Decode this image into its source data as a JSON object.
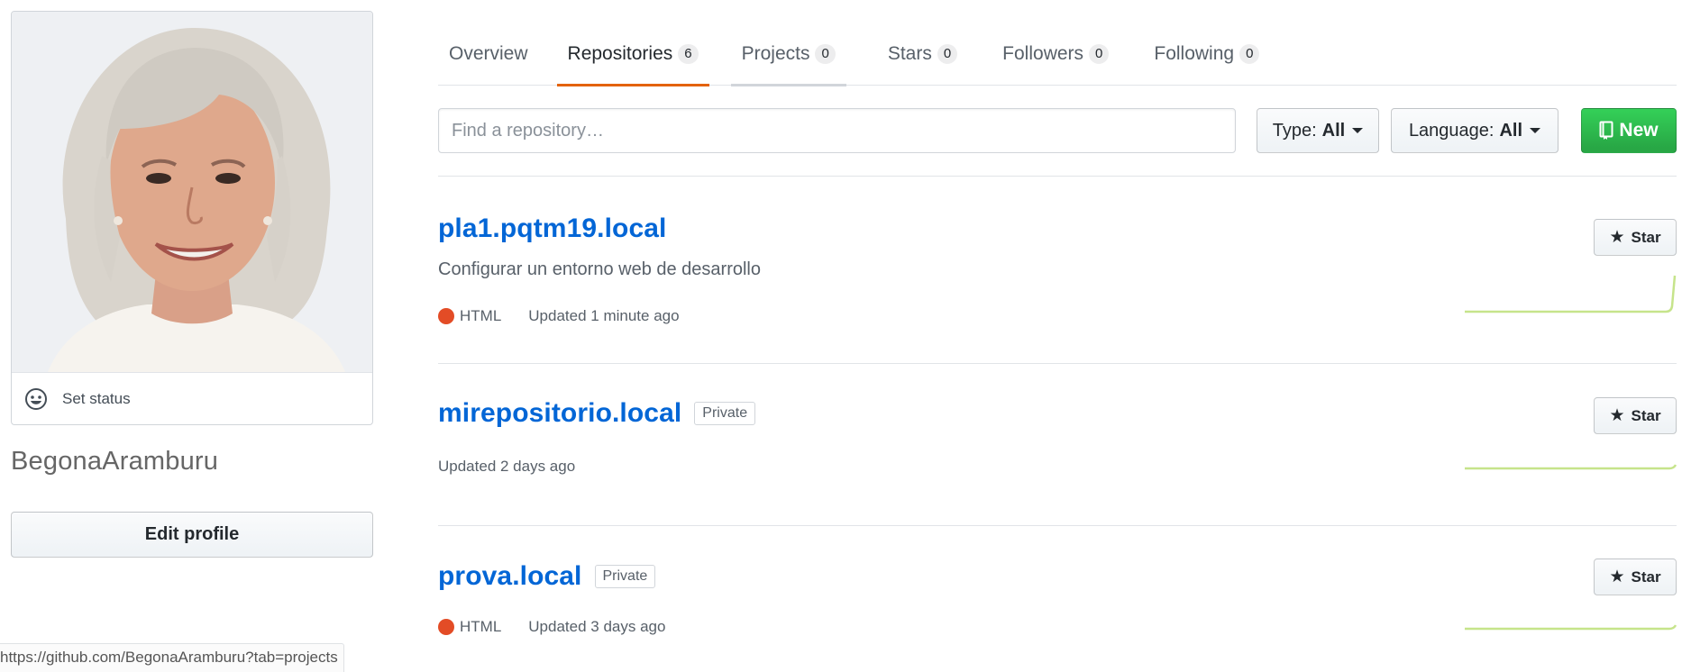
{
  "profile": {
    "set_status_label": "Set status",
    "username": "BegonaAramburu",
    "edit_profile_label": "Edit profile"
  },
  "status_bar": {
    "url": "https://github.com/BegonaAramburu?tab=projects"
  },
  "tabs": [
    {
      "label": "Overview",
      "count": null
    },
    {
      "label": "Repositories",
      "count": "6"
    },
    {
      "label": "Projects",
      "count": "0"
    },
    {
      "label": "Stars",
      "count": "0"
    },
    {
      "label": "Followers",
      "count": "0"
    },
    {
      "label": "Following",
      "count": "0"
    }
  ],
  "filters": {
    "search_placeholder": "Find a repository…",
    "type_label": "Type:",
    "type_value": "All",
    "language_label": "Language:",
    "language_value": "All",
    "new_label": "New"
  },
  "repos": [
    {
      "name": "pla1.pqtm19.local",
      "description": "Configurar un entorno web de desarrollo",
      "language": "HTML",
      "language_color": "#e34c26",
      "updated": "Updated 1 minute ago",
      "star_label": "Star"
    },
    {
      "name": "mirepositorio.local",
      "badge": "Private",
      "updated": "Updated 2 days ago",
      "star_label": "Star"
    },
    {
      "name": "prova.local",
      "badge": "Private",
      "language": "HTML",
      "language_color": "#e34c26",
      "updated": "Updated 3 days ago",
      "star_label": "Star"
    }
  ],
  "colors": {
    "link": "#0366d6",
    "selected_tab_underline": "#e36209",
    "new_button": "#28a745",
    "sparkline": "#c6e48b"
  },
  "icons": {
    "status": "smiley-icon",
    "new": "repo-icon",
    "star": "star-icon",
    "caret": "caret-down-icon"
  }
}
